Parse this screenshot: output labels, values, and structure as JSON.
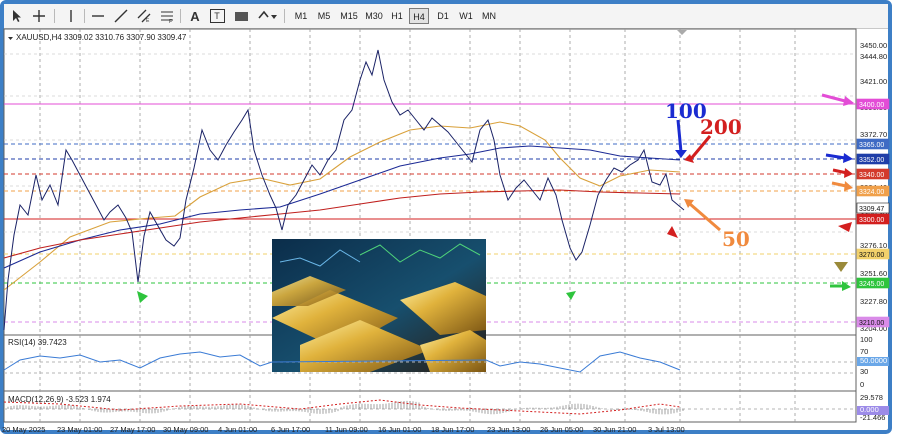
{
  "window": {
    "accent": "#3d7fc6"
  },
  "toolbar": {
    "tools": [
      "cursor-icon",
      "crosshair-icon",
      "vertical-line-icon",
      "horizontal-line-icon",
      "trend-line-icon",
      "equidistant-channel-icon",
      "fibonacci-icon",
      "text-icon",
      "text-label-icon",
      "rectangle-icon",
      "shapes-menu-icon"
    ],
    "timeframes": [
      "M1",
      "M5",
      "M15",
      "M30",
      "H1",
      "H4",
      "D1",
      "W1",
      "MN"
    ],
    "active_timeframe": "H4"
  },
  "chart": {
    "header": "XAUUSD,H4  3309.02 3310.76 3307.90 3309.47",
    "price_labels": [
      "3450.00",
      "3444.80",
      "3421.00",
      "3396.80",
      "3372.70",
      "3348.50",
      "3324.40",
      "3300.30",
      "3276.10",
      "3251.60",
      "3227.80",
      "3204.00"
    ],
    "price_tags": [
      {
        "text": "3400.00",
        "color": "#e34dd6"
      },
      {
        "text": "3365.00",
        "color": "#3f6bc4"
      },
      {
        "text": "3352.00",
        "color": "#1f3ea8"
      },
      {
        "text": "3340.00",
        "color": "#d33a2c"
      },
      {
        "text": "3324.00",
        "color": "#f0a04a"
      },
      {
        "text": "3309.47",
        "color": "#ffffff"
      },
      {
        "text": "3300.00",
        "color": "#d31f1f"
      },
      {
        "text": "3270.00",
        "color": "#f2d16b"
      },
      {
        "text": "3245.00",
        "color": "#2ec43d"
      },
      {
        "text": "3210.00",
        "color": "#d98be8"
      }
    ],
    "date_labels": [
      "20 May 2025",
      "23 May 01:00",
      "27 May 17:00",
      "30 May 09:00",
      "4 Jun 01:00",
      "6 Jun 17:00",
      "11 Jun 09:00",
      "16 Jun 01:00",
      "18 Jun 17:00",
      "23 Jun 13:00",
      "26 Jun 05:00",
      "30 Jun 21:00",
      "3 Jul 13:00"
    ],
    "annotations": {
      "ma100": "100",
      "ma200": "200",
      "ma50": "50"
    }
  },
  "rsi": {
    "label": "RSI(14) 39.7423",
    "levels": [
      "100",
      "70",
      "50.0000",
      "30",
      "0"
    ]
  },
  "macd": {
    "label": "MACD(12,26,9) -3.523 1.974",
    "levels": [
      "29.578",
      "0.000",
      "-21.466"
    ]
  }
}
